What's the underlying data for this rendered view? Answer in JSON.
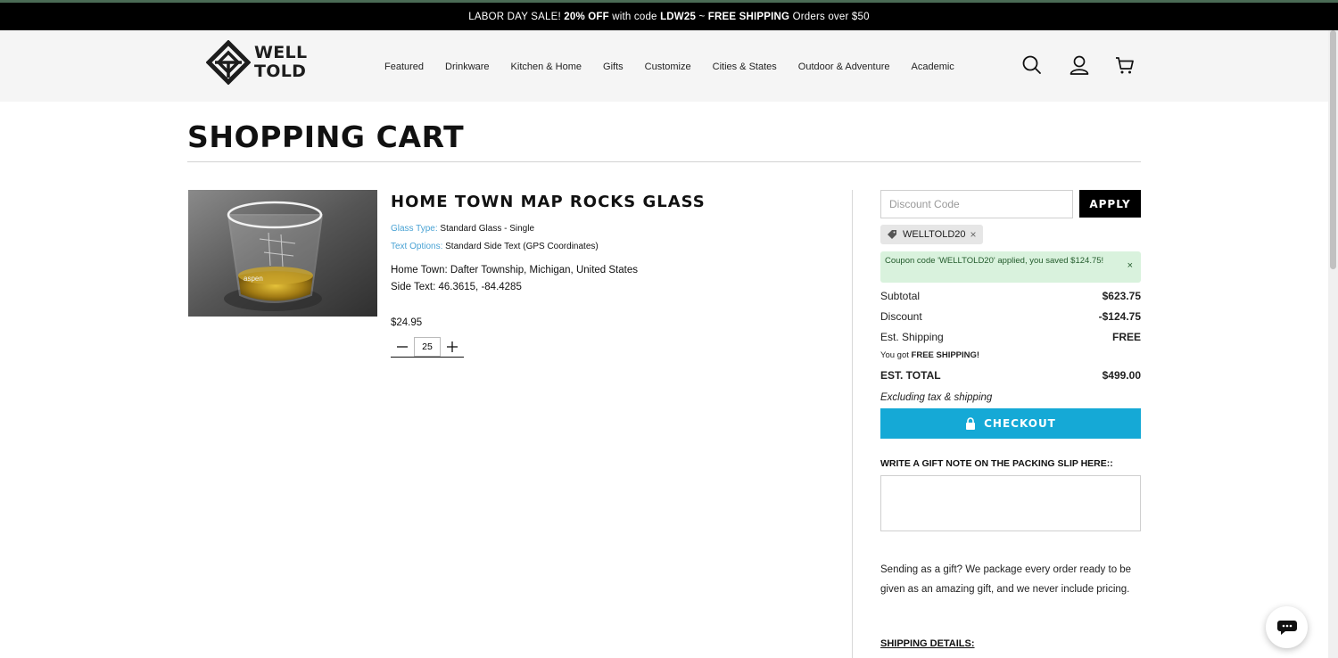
{
  "announcement": {
    "prefix": "LABOR DAY SALE! ",
    "discount": "20% OFF",
    "mid": " with code ",
    "code": "LDW25",
    "sep": " ~ ",
    "shipping": "FREE SHIPPING",
    "suffix": " Orders over $50"
  },
  "header": {
    "logo_line1": "WELL",
    "logo_line2": "TOLD",
    "nav": [
      "Featured",
      "Drinkware",
      "Kitchen & Home",
      "Gifts",
      "Customize",
      "Cities & States",
      "Outdoor & Adventure",
      "Academic"
    ],
    "icons": [
      "search-icon",
      "account-icon",
      "cart-icon"
    ]
  },
  "page": {
    "title": "SHOPPING CART"
  },
  "item": {
    "name": "HOME TOWN MAP ROCKS GLASS",
    "options": [
      {
        "key": "Glass Type:",
        "value": " Standard Glass - Single"
      },
      {
        "key": "Text Options:",
        "value": " Standard Side Text (GPS Coordinates)"
      }
    ],
    "hometown": "Home Town: Dafter Township, Michigan, United States",
    "sidetext": "Side Text: 46.3615, -84.4285",
    "price": "$24.95",
    "quantity": "25",
    "image_label": "aspen"
  },
  "summary": {
    "discount_placeholder": "Discount Code",
    "apply_label": "APPLY",
    "coupon_tag": "WELLTOLD20",
    "coupon_alert": "Coupon code 'WELLTOLD20' applied, you saved $124.75!",
    "rows": [
      {
        "label": "Subtotal",
        "value": "$623.75"
      },
      {
        "label": "Discount",
        "value": "-$124.75"
      },
      {
        "label": "Est. Shipping",
        "value": "FREE"
      }
    ],
    "free_ship_prefix": "You got ",
    "free_ship_strong": "FREE SHIPPING!",
    "total_label": "EST. TOTAL",
    "total_value": "$499.00",
    "excl_note": "Excluding tax & shipping",
    "checkout_label": "CHECKOUT",
    "gift_note_label": "WRITE A GIFT NOTE ON THE PACKING SLIP HERE::",
    "gift_text": "Sending as a gift? We package every order ready to be given as an amazing gift, and we never include pricing.",
    "shipping_details": "SHIPPING DETAILS:"
  },
  "colors": {
    "accent": "#15a9d6",
    "option_key": "#4aa3d4",
    "alert_bg": "#d9f2dd",
    "announcement_bg": "#000000"
  }
}
